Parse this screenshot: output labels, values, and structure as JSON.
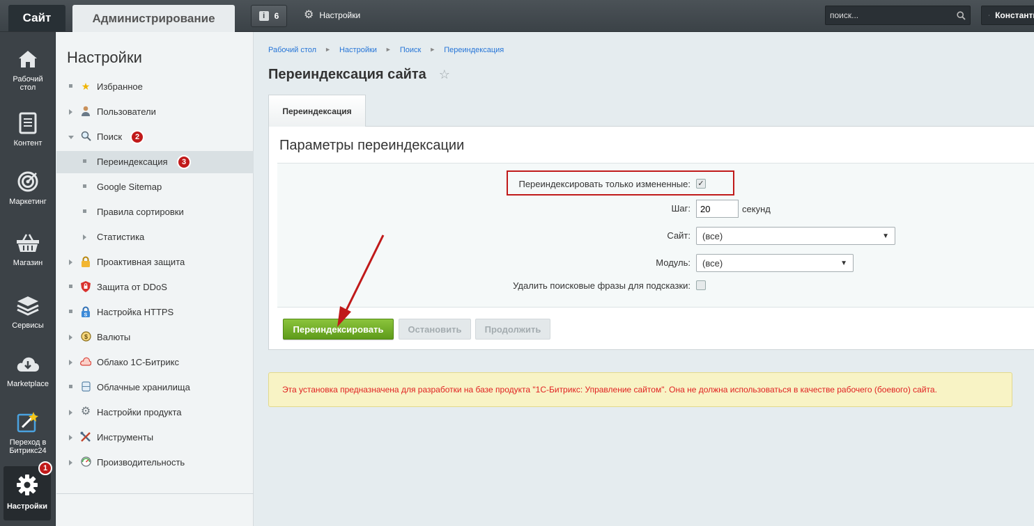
{
  "topbar": {
    "tab_site": "Сайт",
    "tab_admin": "Администрирование",
    "notifications_count": "6",
    "settings_label": "Настройки",
    "search_placeholder": "поиск...",
    "user_name": "Константин"
  },
  "leftnav": {
    "items": [
      {
        "label": "Рабочий стол",
        "icon": "home-icon"
      },
      {
        "label": "Контент",
        "icon": "document-icon"
      },
      {
        "label": "Маркетинг",
        "icon": "target-icon"
      },
      {
        "label": "Магазин",
        "icon": "basket-icon"
      },
      {
        "label": "Сервисы",
        "icon": "layers-icon"
      },
      {
        "label": "Marketplace",
        "icon": "cloud-download-icon"
      },
      {
        "label": "Переход в Битрикс24",
        "icon": "magic-wand-icon"
      },
      {
        "label": "Настройки",
        "icon": "gear-icon",
        "active": true,
        "badge": "1"
      }
    ]
  },
  "sidebar": {
    "title": "Настройки",
    "items": [
      {
        "label": "Избранное",
        "icon": "star-icon",
        "marker": "bullet"
      },
      {
        "label": "Пользователи",
        "icon": "user-icon",
        "marker": "arrow"
      },
      {
        "label": "Поиск",
        "icon": "magnifier-icon",
        "marker": "arrow-down",
        "badge": "2"
      },
      {
        "label": "Переиндексация",
        "marker": "bullet",
        "sub": true,
        "selected": true,
        "badge": "3"
      },
      {
        "label": "Google Sitemap",
        "marker": "bullet",
        "sub": true
      },
      {
        "label": "Правила сортировки",
        "marker": "bullet",
        "sub": true
      },
      {
        "label": "Статистика",
        "marker": "arrow",
        "sub": true
      },
      {
        "label": "Проактивная защита",
        "icon": "lock-icon",
        "marker": "arrow"
      },
      {
        "label": "Защита от DDoS",
        "icon": "shield-icon",
        "marker": "bullet"
      },
      {
        "label": "Настройка HTTPS",
        "icon": "https-lock-icon",
        "marker": "bullet"
      },
      {
        "label": "Валюты",
        "icon": "coin-icon",
        "marker": "arrow"
      },
      {
        "label": "Облако 1С-Битрикс",
        "icon": "cloud-icon",
        "marker": "arrow"
      },
      {
        "label": "Облачные хранилища",
        "icon": "storage-icon",
        "marker": "bullet"
      },
      {
        "label": "Настройки продукта",
        "icon": "gear-small-icon",
        "marker": "arrow"
      },
      {
        "label": "Инструменты",
        "icon": "tools-icon",
        "marker": "arrow"
      },
      {
        "label": "Производительность",
        "icon": "speedometer-icon",
        "marker": "arrow"
      }
    ]
  },
  "breadcrumbs": [
    "Рабочий стол",
    "Настройки",
    "Поиск",
    "Переиндексация"
  ],
  "page_title": "Переиндексация сайта",
  "page_tab": "Переиндексация",
  "panel_title": "Параметры переиндексации",
  "form": {
    "only_changed_label": "Переиндексировать только измененные:",
    "only_changed_checked": true,
    "step_label": "Шаг:",
    "step_value": "20",
    "step_unit": "секунд",
    "site_label": "Сайт:",
    "site_value": "(все)",
    "module_label": "Модуль:",
    "module_value": "(все)",
    "delete_phrases_label": "Удалить поисковые фразы для подсказки:",
    "delete_phrases_checked": false
  },
  "buttons": {
    "reindex": "Переиндексировать",
    "stop": "Остановить",
    "continue": "Продолжить"
  },
  "alert": "Эта установка предназначена для разработки на базе продукта \"1С-Битрикс: Управление сайтом\". Она не должна использоваться в качестве рабочего (боевого) сайта.",
  "colors": {
    "topbar": "#43494e",
    "leftnav": "#3c4247",
    "highlight": "#c01a1a",
    "primary_button": "#6fad24",
    "alert_text": "#e02020",
    "link": "#2675d7"
  }
}
